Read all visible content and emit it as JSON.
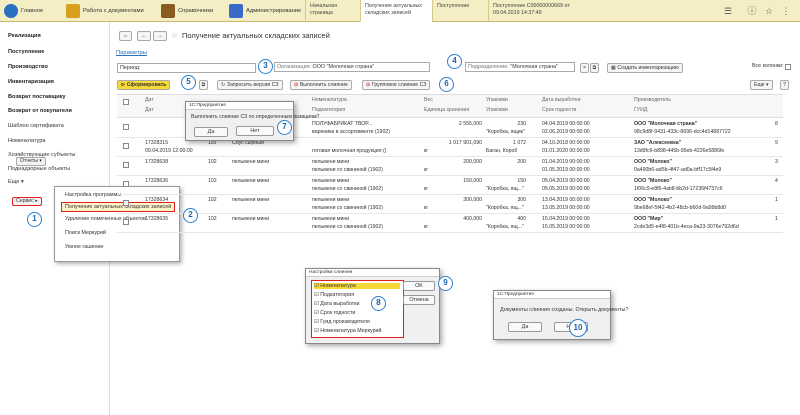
{
  "topbar": {
    "sections": [
      {
        "label": "Главное",
        "icon": "logo-icon",
        "color": "#2a6fc0"
      },
      {
        "label": "Работа с документами",
        "icon": "folders-icon",
        "color": "#d9a020"
      },
      {
        "label": "Справочники",
        "icon": "books-icon",
        "color": "#8a5a20"
      },
      {
        "label": "Администрирование",
        "icon": "tools-icon",
        "color": "#3a6ac8"
      }
    ],
    "tabs": [
      "Начальная страница",
      "Получение актуальных складских записей",
      "Поступление",
      "Поступление С00000000669 от 09.04.2019 14:37:49"
    ]
  },
  "sidebar": {
    "items": [
      "Реализация",
      "Поступление",
      "Производство",
      "Инвентаризация",
      "Возврат поставщику",
      "Возврат от покупателя",
      "Шаблон сертификата",
      "Номенклатура",
      "Хозяйствующие субъекты",
      "Поднадзорные объекты",
      "Еще"
    ],
    "reports_label": "Отчеты",
    "service_label": "Сервис"
  },
  "popup_menu": {
    "items": [
      "Настройка программы",
      "Получение актуальных складских записей",
      "Удаление помеченных объектов",
      "Поиск Меркурий",
      "Умное гашение"
    ]
  },
  "main": {
    "title": "Получение актуальных складских записей",
    "params_link": "Параметры",
    "period_label": "Период:",
    "org_label": "Организация:",
    "org_value": "ООО \"Молочная страна\"",
    "subdiv_label": "Подразделение:",
    "subdiv_value": "\"Молочная страна\"",
    "create_inv": "Создать инвентаризацию",
    "all_columns": "Все колонки:",
    "btn_form": "Сформировать",
    "btn_request": "Запросить версии СЗ",
    "btn_merge": "Выполнить слияние",
    "btn_group": "Групповое слияние СЗ",
    "more": "Еще",
    "help": "?"
  },
  "table": {
    "headers": [
      "Номенклатура",
      "Вес",
      "Упаковки",
      "Дата выработки",
      "Производитель"
    ],
    "subheaders": [
      "Дат",
      "Подкатегория",
      "Единица хранения",
      "Упаковки",
      "Срок годности",
      "ГУИД"
    ],
    "rows": [
      {
        "id": "",
        "date": "",
        "gr": "",
        "name": "",
        "nom": "ПОЛУФАБРИКАТ ТВОР...",
        "sub": "вареники в ассортименте (1902)",
        "w": "2 555,000",
        "u": "",
        "pk": "230",
        "pk2": "\"Коробка, ящик\"",
        "dv": "04.04.2019 00:00:00",
        "sg": "02.06.2019 00:00:00",
        "pr": "ООО \"Молочная страна\"",
        "guid": "98c9d8f-9431-433c-8696-dcc4d14887722",
        "c": "8"
      },
      {
        "id": "17328315",
        "date": "09.04.2019 12:00:00",
        "gr": "110",
        "name": "Соус сырный",
        "nom": "",
        "sub": "готовая молочная продукция ()",
        "w": "1 017 901,090",
        "u": "кг",
        "pk": "1 072",
        "pk2": "Баган, Короб",
        "dv": "04.10.2018 00:00:00",
        "sg": "01.01.2020 00:00:00",
        "pr": "ЗАО \"Алексеевка\"",
        "guid": "13d9fc6-b898-445b-95eb-4226e5886fe",
        "c": "9"
      },
      {
        "id": "17328638",
        "date": "",
        "gr": "102",
        "name": "пельмени мини",
        "nom": "пельмени мини",
        "sub": "пельмени со свининой (1902)",
        "w": "200,000",
        "u": "кг",
        "pk": "200",
        "pk2": "",
        "dv": "01.04.2019 00:00:00",
        "sg": "01.05.2019 00:00:00",
        "pr": "ООО \"Молоко\"",
        "guid": "0a490b6-ad5b-4f47-ad0a-bff17c5f4e9",
        "c": "3"
      },
      {
        "id": "17328636",
        "date": "",
        "gr": "102",
        "name": "пельмени мини",
        "nom": "пельмени мини",
        "sub": "пельмени со свининой (1902)",
        "w": "150,000",
        "u": "кг",
        "pk": "150",
        "pk2": "\"Коробка, ящ...\"",
        "dv": "05.04.2019 00:00:00",
        "sg": "05.05.2019 00:00:00",
        "pr": "ООО \"Молоко\"",
        "guid": "1f06c9-e8f6-4ab8-bb2d-17236f4737c6",
        "c": "4"
      },
      {
        "id": "17328634",
        "date": "",
        "gr": "102",
        "name": "пельмени мини",
        "nom": "пельмени мини",
        "sub": "пельмени со свининой (1902)",
        "w": "300,000",
        "u": "кг",
        "pk": "300",
        "pk2": "\"Коробка, ящ...\"",
        "dv": "13.04.2019 00:00:00",
        "sg": "13.05.2019 00:00:00",
        "pr": "ООО \"Молоко\"",
        "guid": "9be68ef-5f42-4b2-48cb-b60d-9a99b8d0",
        "c": "1"
      },
      {
        "id": "17328635",
        "date": "",
        "gr": "102",
        "name": "пельмени мини",
        "nom": "пельмени мини",
        "sub": "пельмени со свининой (1902)",
        "w": "400,000",
        "u": "кг",
        "pk": "400",
        "pk2": "\"Коробка, ящ...\"",
        "dv": "15.04.2019 00:00:00",
        "sg": "15.05.2019 00:00:00",
        "pr": "ООО \"Мир\"",
        "guid": "2cde3d5-e4f8-401b-4eca-9a23-3076e792d6d",
        "c": "1"
      }
    ]
  },
  "dialog1": {
    "title": "1С:Предприятие",
    "question": "Выполнить слияние СЗ по определенным позициям?",
    "yes": "Да",
    "no": "Нет"
  },
  "dialog2": {
    "title": "Настройки слияния",
    "items": [
      "Номенклатура",
      "Подкатегория",
      "Дата выработки",
      "Срок годности",
      "Гуид производителя",
      "Номенклатура Меркурий"
    ],
    "ok": "OK",
    "cancel": "Отмена"
  },
  "dialog3": {
    "title": "1С:Предприятие",
    "message": "Документы слияния созданы. Открыть документы?",
    "yes": "Да",
    "no": "Нет"
  },
  "markers": [
    "1",
    "2",
    "3",
    "4",
    "5",
    "6",
    "7",
    "8",
    "9",
    "10"
  ]
}
